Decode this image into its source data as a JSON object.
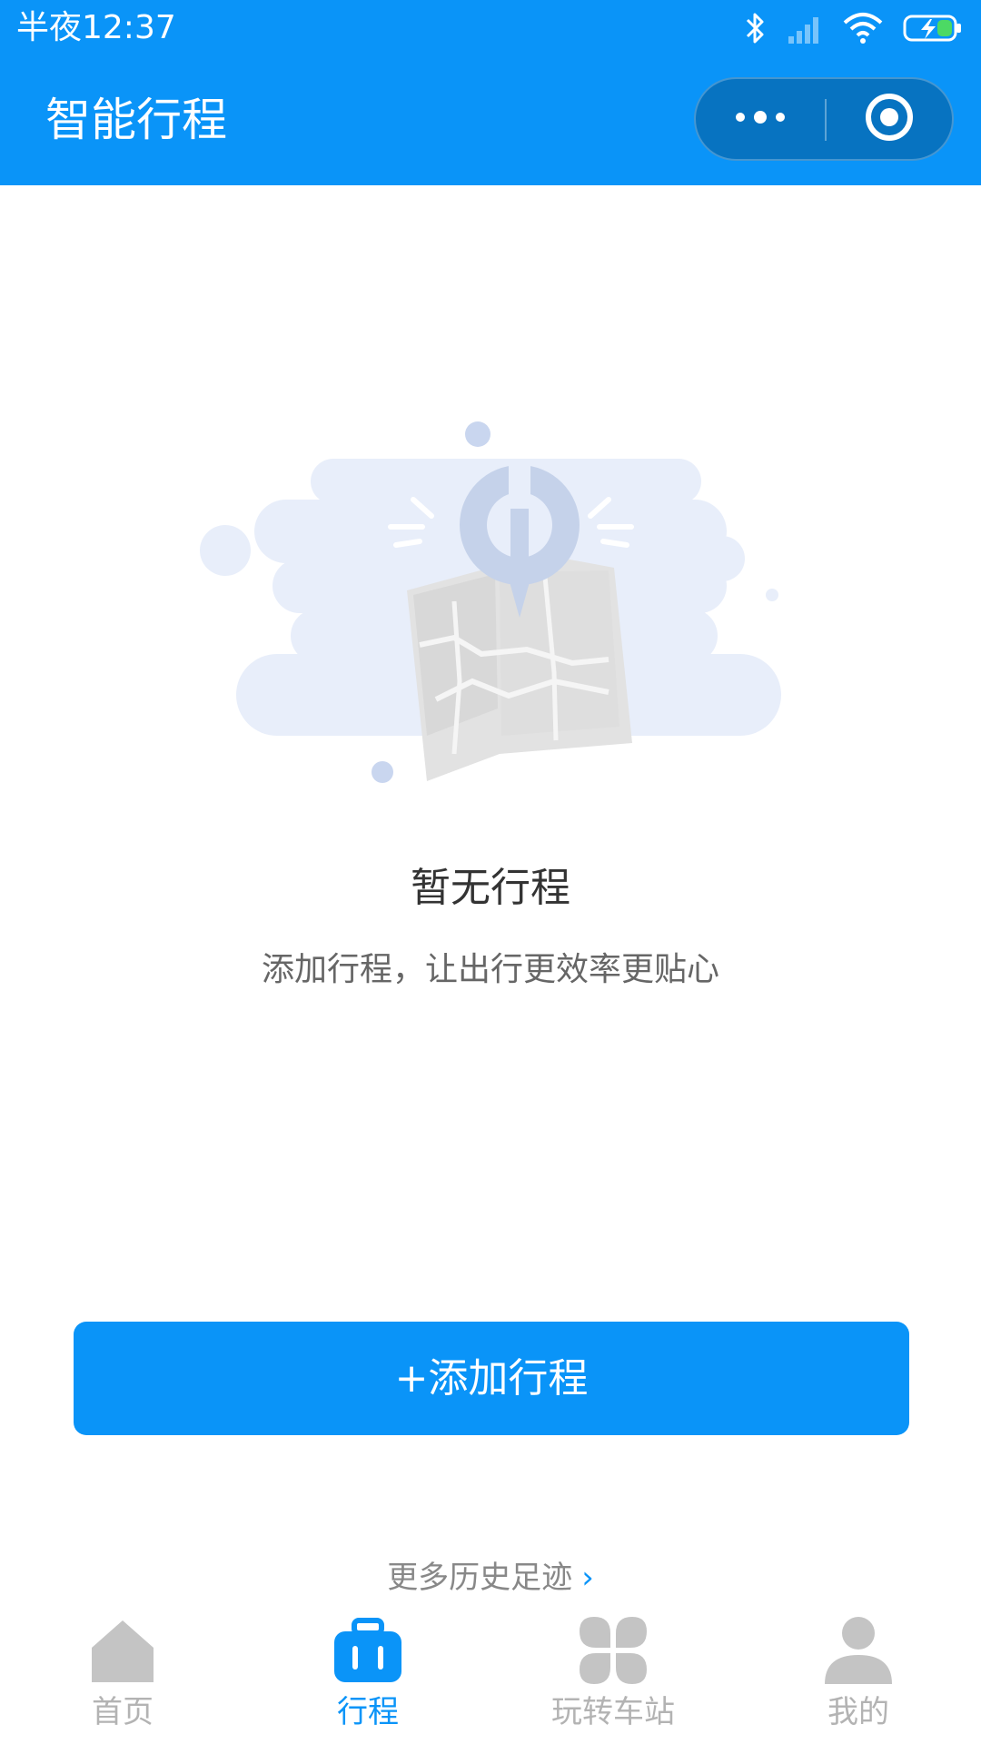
{
  "status_bar": {
    "time": "半夜12:37"
  },
  "nav": {
    "title": "智能行程",
    "more_icon": "more-dots-icon",
    "close_icon": "target-close-icon"
  },
  "empty_state": {
    "illustration": "map-broken-illustration",
    "title": "暂无行程",
    "subtitle": "添加行程，让出行更效率更贴心"
  },
  "actions": {
    "add_label": "+添加行程",
    "history_label": "更多历史足迹",
    "history_chevron": "›"
  },
  "tabbar": {
    "tabs": [
      {
        "label": "首页",
        "icon": "home-icon",
        "active": false
      },
      {
        "label": "行程",
        "icon": "suitcase-icon",
        "active": true
      },
      {
        "label": "玩转车站",
        "icon": "four-leaf-grid-icon",
        "active": false
      },
      {
        "label": "我的",
        "icon": "person-icon",
        "active": false
      }
    ]
  },
  "colors": {
    "primary": "#0a94f8",
    "inactive": "#b3b3b3",
    "illustration_bg": "#e8eefa"
  }
}
